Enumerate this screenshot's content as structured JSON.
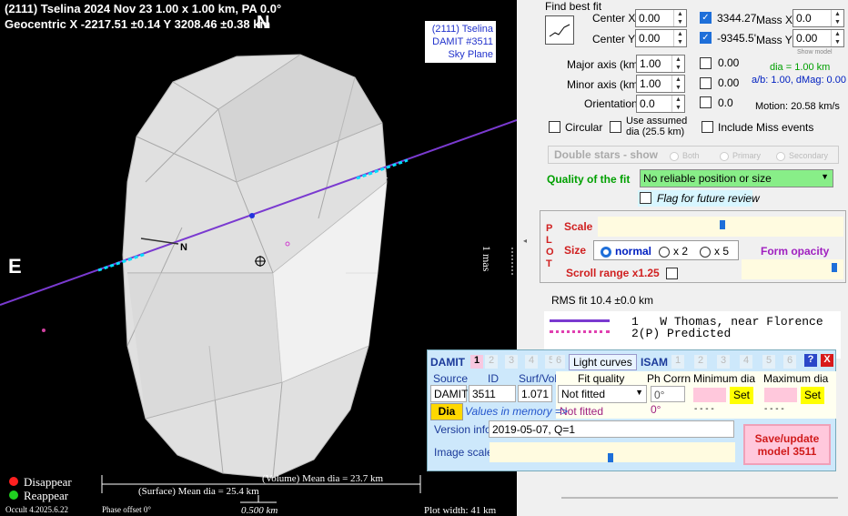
{
  "plot": {
    "header_line1": "(2111) Tselina  2024 Nov 23  1.00 x 1.00 km, PA 0.0°",
    "header_line2": "Geocentric  X  -2217.51 ±0.14  Y 3208.46 ±0.38 km",
    "info": [
      "(2111) Tselina",
      "DAMIT #3511",
      "Sky Plane"
    ],
    "north": "N",
    "east": "E",
    "model_n": "N",
    "chord_label": "1",
    "mas_label": "1 mas",
    "legend_disappear": "Disappear",
    "legend_reappear": "Reappear",
    "volume_dia": "(Volume) Mean dia = 23.7 km",
    "surface_dia": "(Surface) Mean dia = 25.4 km",
    "version": "Occult 4.2025.6.22",
    "phase_offset": "Phase offset 0°",
    "scale_km": "0.500 km",
    "plot_width": "Plot width: 41 km",
    "colors": {
      "disappear": "#ff2020",
      "reappear": "#20d020",
      "chord": "#7a3ad0"
    }
  },
  "fit": {
    "title": "Find best fit",
    "center_x_label": "Center X",
    "center_x_value": "0.00",
    "center_y_label": "Center Y",
    "center_y_value": "0.00",
    "mass_x_checked_value": "3344.27",
    "mass_x_label": "Mass X",
    "mass_x_value": "0.0",
    "mass_y_checked_value": "-9345.5'",
    "mass_y_label": "Mass Y",
    "mass_y_value": "0.00",
    "major_axis_label": "Major axis (km)",
    "major_axis_value": "1.00",
    "major_axis_fixed": "0.00",
    "minor_axis_label": "Minor axis (km)",
    "minor_axis_value": "1.00",
    "minor_axis_fixed": "0.00",
    "orientation_label": "Orientation",
    "orientation_value": "0.0",
    "orientation_fixed": "0.0",
    "show_model": "Show model",
    "dia_text": "dia = 1.00 km",
    "ab_text": "a/b: 1.00, dMag: 0.00",
    "motion_text": "Motion: 20.58 km/s",
    "circular_label": "Circular",
    "use_assumed_label1": "Use assumed",
    "use_assumed_label2": "dia (25.5 km)",
    "include_miss_label": "Include Miss events",
    "double_stars_label": "Double stars - show",
    "both_label": "Both",
    "primary_label": "Primary",
    "secondary_label": "Secondary",
    "quality_label": "Quality of the fit",
    "quality_value": "No reliable position or size",
    "flag_label": "Flag for future review"
  },
  "plot_ctrl": {
    "plot_letters": [
      "P",
      "L",
      "O",
      "T"
    ],
    "scale_label": "Scale",
    "size_label": "Size",
    "normal_label": "normal",
    "x2_label": "x 2",
    "x5_label": "x 5",
    "form_opacity_label": "Form opacity",
    "scroll_range_label": "Scroll range x1.25"
  },
  "rms": "RMS fit 10.4 ±0.0 km",
  "chord_list": [
    {
      "num": "1",
      "text": "W Thomas, near Florence"
    },
    {
      "num": "2(P)",
      "text": "Predicted"
    }
  ],
  "damit": {
    "title": "DAMIT",
    "tabs": [
      "1",
      "2",
      "3",
      "4",
      "5",
      "6"
    ],
    "light_curves": "Light curves",
    "isam_title": "ISAM",
    "isam_tabs": [
      "1",
      "2",
      "3",
      "4",
      "5",
      "6"
    ],
    "help": "?",
    "close": "X",
    "source_label": "Source",
    "id_label": "ID",
    "surfvol_label": "Surf/Vol",
    "source_value": "DAMIT",
    "id_value": "3511",
    "surfvol_value": "1.071",
    "fit_quality_label": "Fit quality",
    "fit_quality_value": "Not fitted",
    "fit_quality_value2": "Not fitted",
    "ph_corrn_label": "Ph Corrn",
    "ph_corrn_value": "0°",
    "ph_corrn_value2": "0°",
    "min_dia_label": "Minimum dia",
    "max_dia_label": "Maximum dia",
    "set_label": "Set",
    "dashes": "- - - -",
    "dia_button": "Dia",
    "values_memory": "Values in memory =>",
    "version_info_label": "Version info",
    "version_info_value": "2019-05-07, Q=1",
    "image_scale_label": "Image scale",
    "save_button_line1": "Save/update",
    "save_button_line2": "model 3511"
  }
}
